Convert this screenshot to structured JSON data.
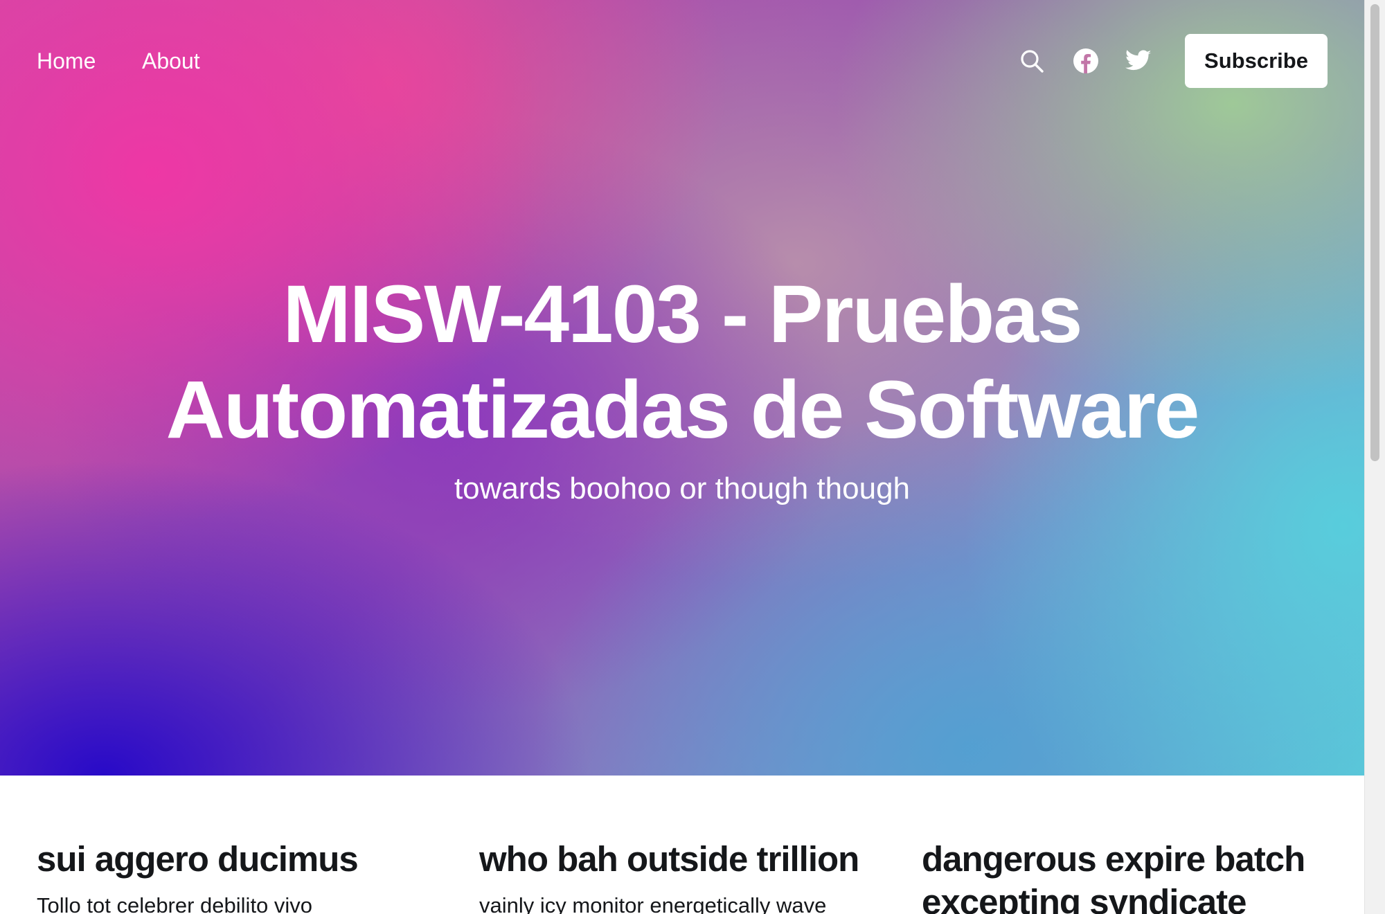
{
  "nav": {
    "home_label": "Home",
    "about_label": "About",
    "subscribe_label": "Subscribe",
    "icons": [
      "search-icon",
      "facebook-icon",
      "twitter-icon"
    ]
  },
  "hero": {
    "title": "MISW-4103 - Pruebas Automatizadas de Software",
    "subtitle": "towards boohoo or though though"
  },
  "posts": [
    {
      "title": "sui aggero ducimus",
      "excerpt": "Tollo tot celebrer debilito vivo"
    },
    {
      "title": "who bah outside trillion",
      "excerpt": "vainly icy monitor energetically wave"
    },
    {
      "title": "dangerous expire batch excepting syndicate",
      "excerpt": ""
    }
  ],
  "colors": {
    "text_dark": "#15171a",
    "hero_pink": "#ee37a5",
    "hero_violet": "#2a0ac8",
    "hero_cyan": "#58cddc",
    "hero_green": "#a0cd96"
  }
}
